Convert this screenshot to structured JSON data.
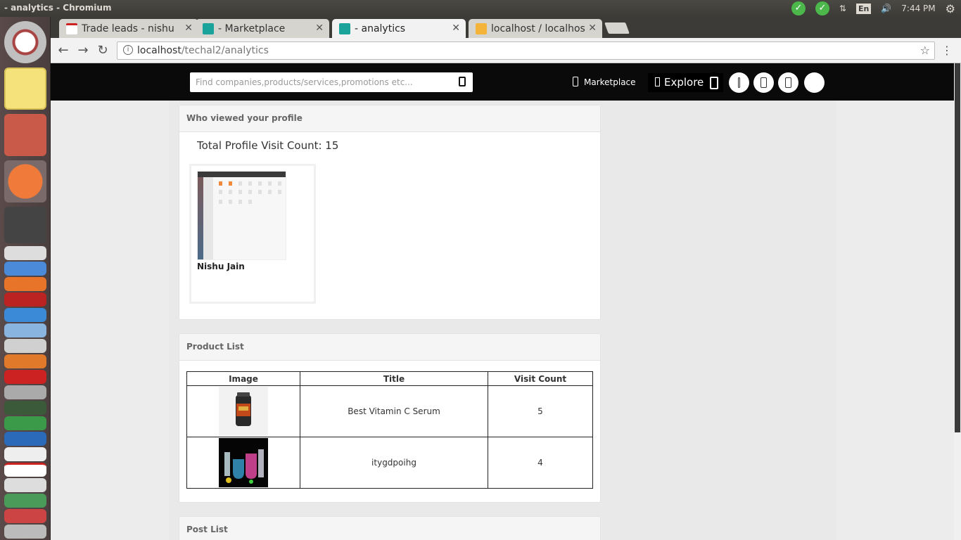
{
  "os": {
    "window_title": "- analytics - Chromium",
    "clock": "7:44 PM",
    "lang": "En"
  },
  "browser": {
    "tabs": [
      {
        "label": "Trade leads - nishu"
      },
      {
        "label": "- Marketplace"
      },
      {
        "label": "- analytics"
      },
      {
        "label": "localhost / localhos"
      }
    ],
    "url_host": "localhost",
    "url_path": "/techal2/analytics"
  },
  "site": {
    "search_placeholder": "Find companies,products/services,promotions etc...",
    "marketplace_label": "Marketplace",
    "explore_label": "Explore"
  },
  "viewers": {
    "title": "Who viewed your profile",
    "total_label": "Total Profile Visit Count: 15",
    "cards": [
      {
        "name": "Nishu Jain"
      }
    ]
  },
  "products": {
    "title": "Product List",
    "columns": [
      "Image",
      "Title",
      "Visit Count"
    ],
    "rows": [
      {
        "title": "Best Vitamin C Serum",
        "visits": "5"
      },
      {
        "title": "itygdpoihg",
        "visits": "4"
      }
    ]
  },
  "posts": {
    "title": "Post List"
  }
}
